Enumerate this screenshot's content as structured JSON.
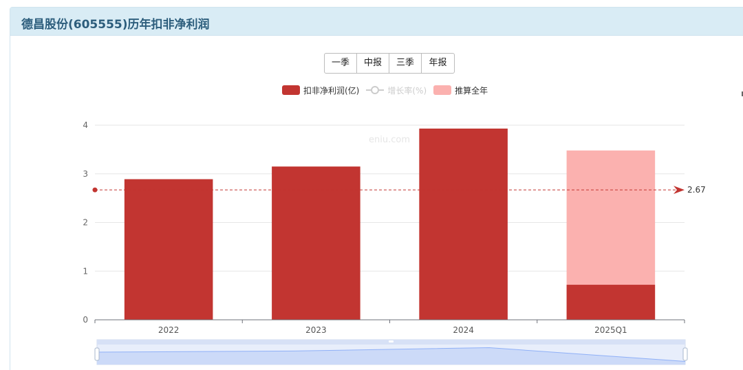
{
  "header": {
    "title": "德昌股份(605555)历年扣非净利润"
  },
  "toolbar": {
    "buttons": [
      "一季",
      "中报",
      "三季",
      "年报"
    ]
  },
  "legend": [
    {
      "label": "扣非净利润(亿)",
      "color": "#c23531",
      "kind": "bar"
    },
    {
      "label": "增长率(%)",
      "color": "#cccccc",
      "kind": "line",
      "disabled": true
    },
    {
      "label": "推算全年",
      "color": "#fbb1af",
      "kind": "bar"
    }
  ],
  "watermark": "eniu.com",
  "chart_data": {
    "type": "bar",
    "categories": [
      "2022",
      "2023",
      "2024",
      "2025Q1"
    ],
    "series": [
      {
        "name": "扣非净利润(亿)",
        "color": "#c23531",
        "values": [
          2.89,
          3.15,
          3.93,
          0.72
        ]
      },
      {
        "name": "推算全年",
        "color": "#fbb1af",
        "values": [
          null,
          null,
          null,
          3.48
        ],
        "stacked_behind": true
      }
    ],
    "yticks": [
      "0",
      "1",
      "2",
      "3",
      "4"
    ],
    "ylim": [
      0,
      4
    ],
    "markline": {
      "value": 2.67,
      "label": "2.67",
      "color": "#c23531",
      "style": "dashed"
    },
    "grid": true,
    "legend_position": "top-center",
    "datazoom": {
      "range": [
        0,
        100
      ],
      "trend": [
        2.89,
        3.15,
        3.93,
        0.72
      ]
    }
  }
}
